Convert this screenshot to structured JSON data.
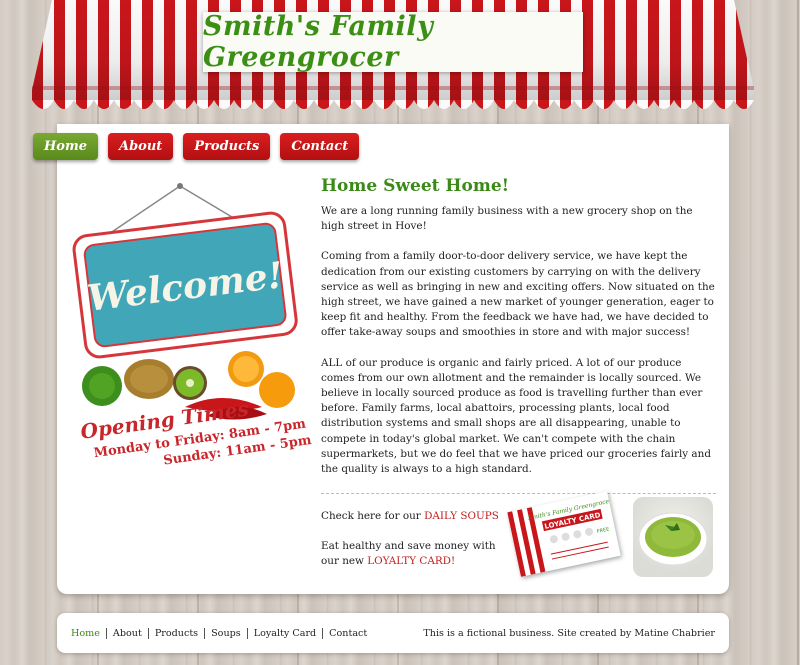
{
  "site_title": "Smith's Family Greengrocer",
  "nav": [
    {
      "label": "Home",
      "active": true
    },
    {
      "label": "About",
      "active": false
    },
    {
      "label": "Products",
      "active": false
    },
    {
      "label": "Contact",
      "active": false
    }
  ],
  "welcome_sign": "Welcome!",
  "opening": {
    "title": "Opening Times",
    "line1": "Monday to Friday: 8am - 7pm",
    "line2": "Sunday: 11am - 5pm"
  },
  "main": {
    "heading": "Home Sweet Home!",
    "paragraphs": [
      "We are a long running family business with a new grocery shop on the high street in Hove!",
      "Coming from a family door-to-door delivery service, we have kept the dedication from our existing customers by carrying on with the delivery service as well as bringing in new and exciting offers. Now situated on the high street, we have gained a new market of younger generation, eager to keep fit and healthy. From the feedback we have had, we have decided to offer take-away soups and smoothies in store and with major success!",
      "ALL of our produce is organic and fairly priced. A lot of our produce comes from our own allotment and the remainder is locally sourced. We believe in locally sourced produce as food is travelling further than ever before. Family farms, local abattoirs, processing plants, local food distribution systems and small shops are all disappearing, unable to compete in today's global market. We can't compete with the chain supermarkets, but we do feel that we have priced our groceries fairly and the quality is always to a high standard."
    ],
    "promo_soups_text": "Check here for our ",
    "promo_soups_link": "DAILY SOUPS",
    "promo_loyalty_text": "Eat healthy and save money with our new ",
    "promo_loyalty_link": "LOYALTY CARD!"
  },
  "loyalty_card": {
    "brand": "Smith's Family Greengrocer",
    "title": "LOYALTY CARD",
    "free": "FREE"
  },
  "footer": {
    "links": [
      "Home",
      "About",
      "Products",
      "Soups",
      "Loyalty Card",
      "Contact"
    ],
    "credit": "This is a fictional business. Site created by Matine Chabrier"
  },
  "colors": {
    "brand_green": "#3b8a17",
    "awning_red": "#c8161b",
    "nav_red": "#c41616",
    "nav_green": "#6b9a28",
    "link_red": "#c21b1b"
  }
}
